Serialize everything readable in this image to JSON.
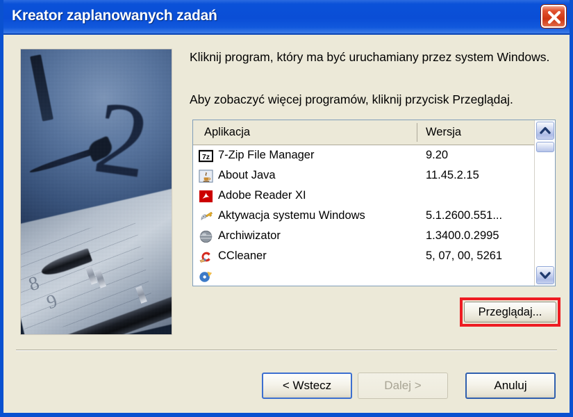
{
  "window": {
    "title": "Kreator zaplanowanych zadań",
    "close_icon": "close-icon",
    "titlebar_color": "#0A51D8",
    "background_color": "#ECE9D8"
  },
  "side_image": {
    "alt": "clock-and-pen-illustration",
    "clock_digit_12": "2",
    "planner_digit_8": "8",
    "planner_digit_9": "9"
  },
  "instructions": {
    "line1": "Kliknij program, który ma być uruchamiany przez system Windows.",
    "line2": "Aby zobaczyć więcej programów, kliknij przycisk Przeglądaj."
  },
  "list": {
    "columns": [
      "Aplikacja",
      "Wersja"
    ],
    "rows": [
      {
        "icon": "sevenzip-icon",
        "name": "7-Zip File Manager",
        "version": "9.20"
      },
      {
        "icon": "java-icon",
        "name": "About Java",
        "version": "11.45.2.15"
      },
      {
        "icon": "adobe-icon",
        "name": "Adobe Reader XI",
        "version": ""
      },
      {
        "icon": "key-icon",
        "name": "Aktywacja systemu Windows",
        "version": "5.1.2600.551..."
      },
      {
        "icon": "globe-icon",
        "name": "Archiwizator",
        "version": "1.3400.0.2995"
      },
      {
        "icon": "ccleaner-icon",
        "name": "CCleaner",
        "version": "5, 07, 00, 5261"
      },
      {
        "icon": "cdburner-icon",
        "name": "",
        "version": ""
      }
    ],
    "scrollbar": {
      "up_icon": "chevron-up-icon",
      "down_icon": "chevron-down-icon"
    }
  },
  "browse": {
    "label": "Przeglądaj...",
    "highlight_color": "#EE1C22"
  },
  "footer": {
    "back_label": "< Wstecz",
    "next_label": "Dalej >",
    "cancel_label": "Anuluj"
  }
}
